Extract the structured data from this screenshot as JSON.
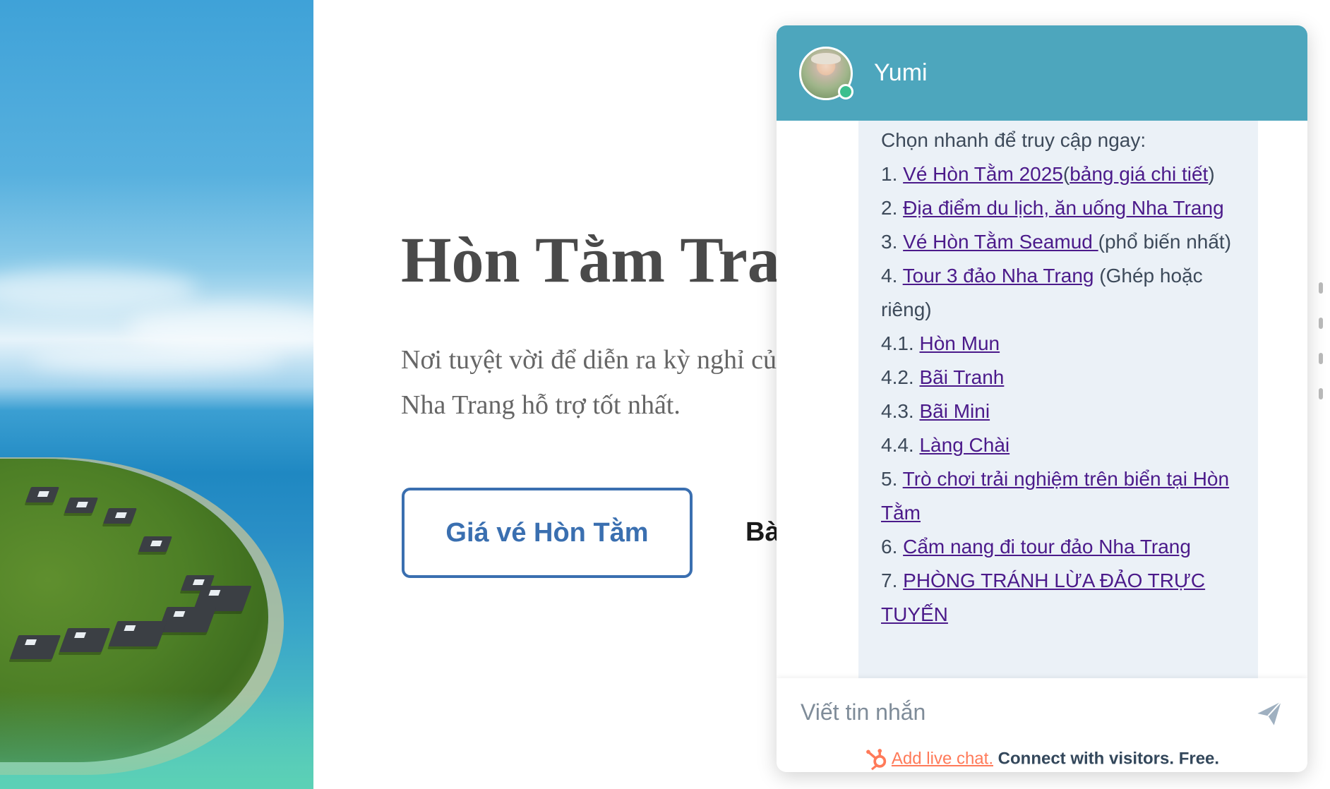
{
  "hero": {
    "title": "Hòn Tằm Trav",
    "description": "Nơi tuyệt vời để diễn ra kỳ nghỉ củ Nha Trang hỗ trợ tốt nhất.",
    "primary_button": "Giá vé Hòn Tằm",
    "secondary_link": "Bà"
  },
  "chat": {
    "agent_name": "Yumi",
    "intro": "Chọn nhanh để truy cập ngay:",
    "menu": {
      "i1_num": "1.",
      "i1_link": "Vé Hòn Tằm 2025",
      "i1_open": "(",
      "i1_sub_link": "bảng giá chi tiết",
      "i1_close": ")",
      "i2_num": "2.",
      "i2_link": "Địa điểm du lịch, ăn uống Nha Trang",
      "i3_num": "3.",
      "i3_link": "Vé Hòn Tằm Seamud ",
      "i3_note": "(phổ biến nhất)",
      "i4_num": "4.",
      "i4_link": "Tour 3 đảo Nha Trang",
      "i4_note": "(Ghép hoặc riêng)",
      "i41_num": "4.1.",
      "i41_link": "Hòn Mun",
      "i42_num": "4.2.",
      "i42_link": "Bãi Tranh",
      "i43_num": "4.3.",
      "i43_link": "Bãi Mini",
      "i44_num": "4.4.",
      "i44_link": "Làng Chài",
      "i5_num": "5.",
      "i5_link": "Trò chơi trải nghiệm trên biển tại Hòn Tằm",
      "i6_num": "6.",
      "i6_link": "Cẩm nang đi tour đảo Nha Trang",
      "i7_num": "7.",
      "i7_link": "PHÒNG TRÁNH LỪA ĐẢO TRỰC TUYẾN"
    },
    "input_placeholder": "Viết tin nhắn",
    "send_icon": "send-paper-plane-icon",
    "powered_link": "Add live chat.",
    "powered_text": "Connect with visitors. Free.",
    "colors": {
      "header": "#4da6bd",
      "bubble": "#ebf1f7",
      "link": "#4b1a8a",
      "accent": "#ff7a59",
      "online": "#3bbf8e"
    }
  }
}
